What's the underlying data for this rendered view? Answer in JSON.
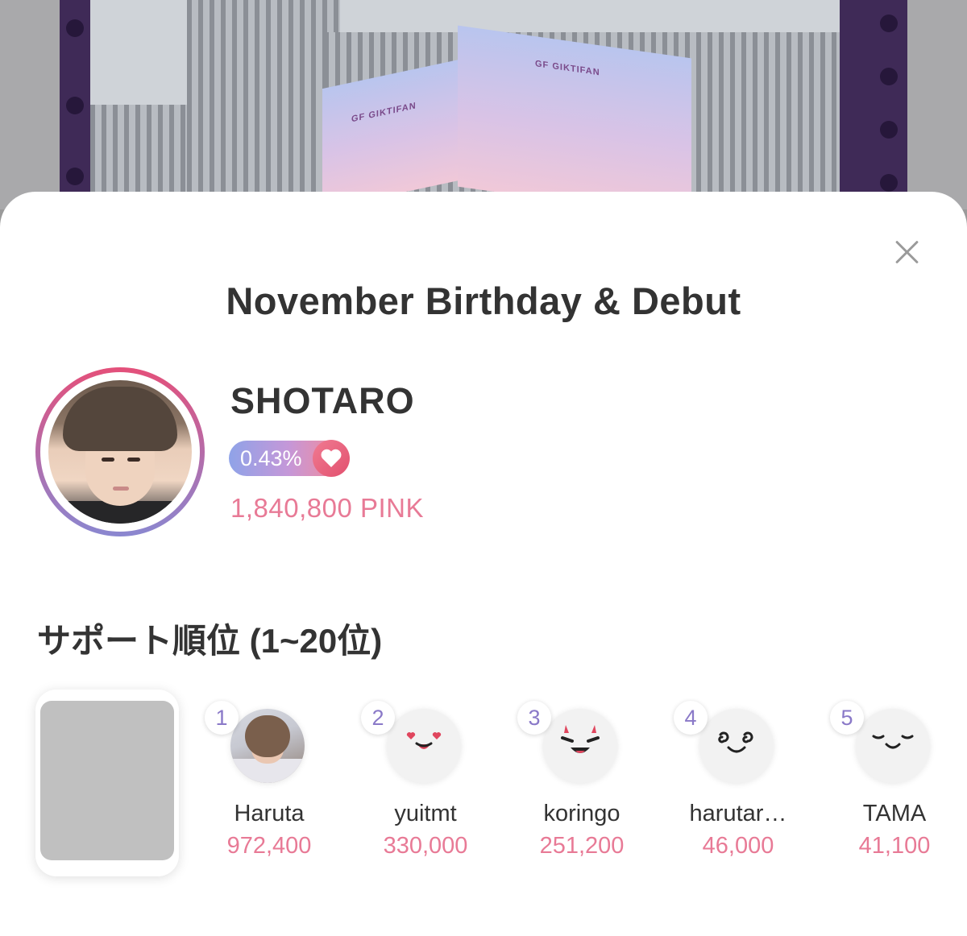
{
  "background": {
    "screen_brand_left": "GF GIKTIFAN",
    "screen_brand_right": "GF GIKTIFAN"
  },
  "modal": {
    "title": "November Birthday & Debut",
    "close_icon": "close-icon"
  },
  "artist": {
    "name": "SHOTARO",
    "percent": "0.43%",
    "percent_value": 0.43,
    "pink_total": "1,840,800 PINK",
    "badge_icon": "heart-icon"
  },
  "ranking": {
    "title": "サポート順位 (1~20位)",
    "supporters": [
      {
        "rank": "1",
        "name": "Haruta",
        "amount": "972,400",
        "avatar": "photo"
      },
      {
        "rank": "2",
        "name": "yuitmt",
        "amount": "330,000",
        "avatar": "heart-eyes-face"
      },
      {
        "rank": "3",
        "name": "koringo",
        "amount": "251,200",
        "avatar": "devil-face"
      },
      {
        "rank": "4",
        "name": "harutar…",
        "amount": "46,000",
        "avatar": "swirl-eyes-face"
      },
      {
        "rank": "5",
        "name": "TAMA",
        "amount": "41,100",
        "avatar": "sleepy-face"
      }
    ]
  },
  "colors": {
    "accent_pink": "#e87a96",
    "rank_number": "#8a79c8",
    "ring_top": "#e4507a",
    "ring_bottom": "#8a87d0"
  }
}
